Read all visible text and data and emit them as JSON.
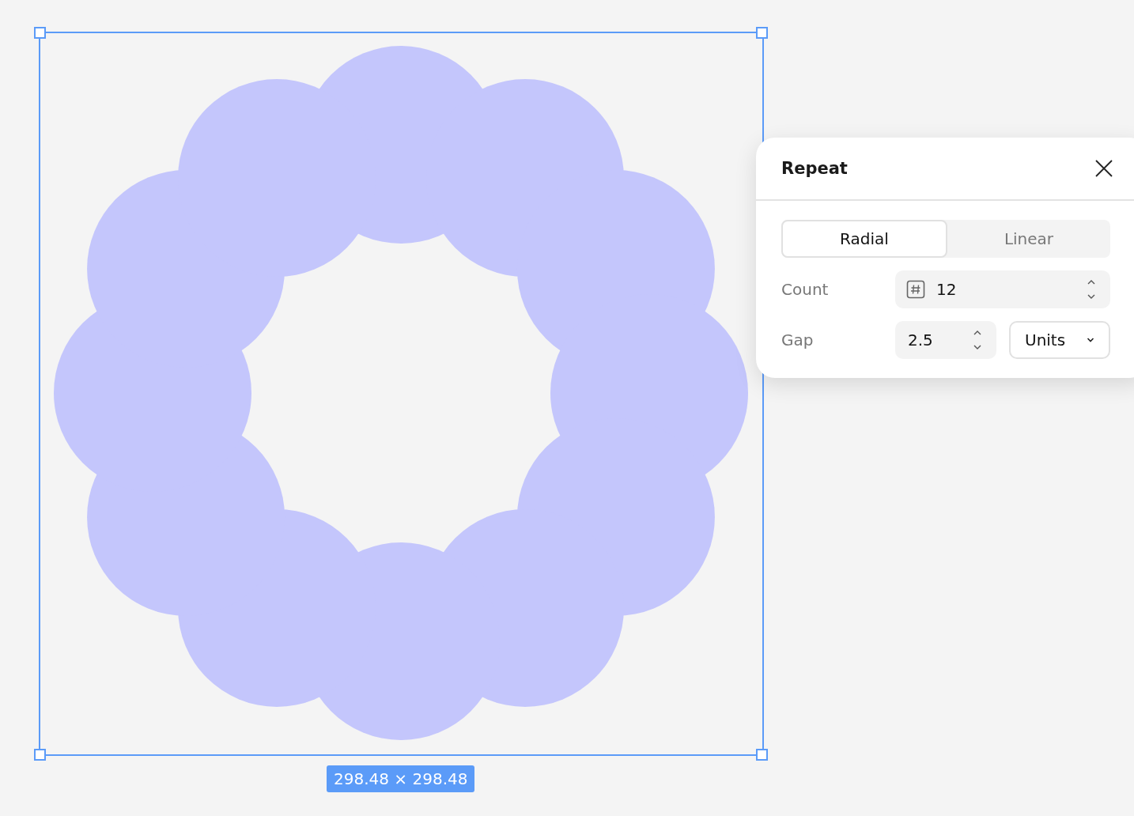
{
  "selection": {
    "size_label": "298.48 × 298.48"
  },
  "panel": {
    "title": "Repeat",
    "tabs": [
      {
        "label": "Radial",
        "selected": true
      },
      {
        "label": "Linear",
        "selected": false
      }
    ],
    "count": {
      "label": "Count",
      "value": "12"
    },
    "gap": {
      "label": "Gap",
      "value": "2.5",
      "unit": "Units"
    }
  }
}
